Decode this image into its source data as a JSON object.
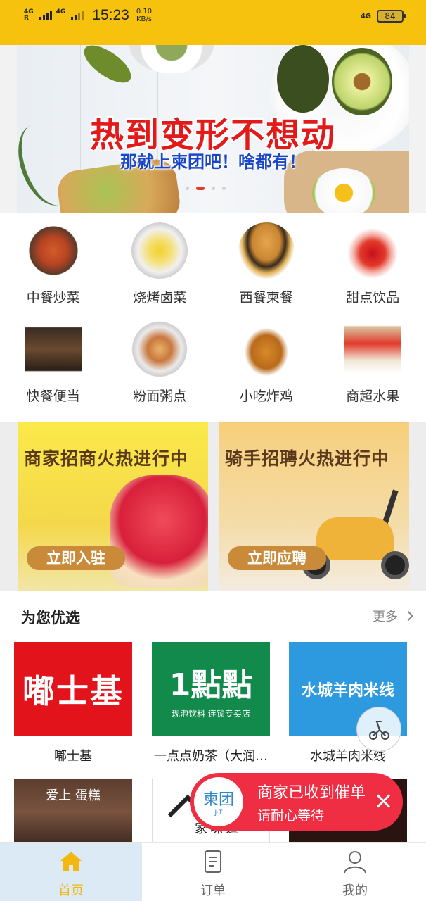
{
  "status_bar": {
    "network1": "4G",
    "network1_sub": "R",
    "network2": "4G",
    "time": "15:23",
    "speed_value": "0.10",
    "speed_unit": "KB/s",
    "network_right": "4G",
    "battery": "84"
  },
  "banner": {
    "title": "热到变形不想动",
    "subtitle": "那就上柬团吧！啥都有！",
    "active_dot": 1,
    "dot_count": 4
  },
  "categories": [
    {
      "label": "中餐炒菜",
      "icon": "stir-fry-icon"
    },
    {
      "label": "烧烤卤菜",
      "icon": "bbq-icon"
    },
    {
      "label": "西餐柬餐",
      "icon": "burger-icon"
    },
    {
      "label": "甜点饮品",
      "icon": "drink-icon"
    },
    {
      "label": "快餐便当",
      "icon": "bento-icon"
    },
    {
      "label": "粉面粥点",
      "icon": "noodle-icon"
    },
    {
      "label": "小吃炸鸡",
      "icon": "fried-chicken-icon"
    },
    {
      "label": "商超水果",
      "icon": "grocery-icon"
    }
  ],
  "promos": [
    {
      "title": "商家招商火热进行中",
      "button": "立即入驻"
    },
    {
      "title": "骑手招聘火热进行中",
      "button": "立即应聘"
    }
  ],
  "recommend": {
    "title": "为您优选",
    "more": "更多",
    "shops": [
      {
        "name": "嘟士基",
        "logo_text": "嘟士基",
        "color": "#e3131c"
      },
      {
        "name": "一点点奶茶（大润…",
        "logo_text": "1點點",
        "logo_sub": "现泡饮料 连锁专卖店",
        "color": "#118a4c"
      },
      {
        "name": "水城羊肉米线",
        "logo_text": "水城羊肉米线",
        "color": "#2d9ae0"
      }
    ],
    "row2": [
      {
        "logo_text": "爱上 蛋糕"
      },
      {
        "logo_text": "家味道"
      },
      {
        "logo_text": ""
      }
    ]
  },
  "toast": {
    "logo_main": "柬团",
    "logo_sub": "J·T",
    "line1": "商家已收到催单",
    "line2": "请耐心等待"
  },
  "tabbar": {
    "tabs": [
      {
        "label": "首页",
        "icon": "home-icon",
        "active": true
      },
      {
        "label": "订单",
        "icon": "order-icon",
        "active": false
      },
      {
        "label": "我的",
        "icon": "user-icon",
        "active": false
      }
    ]
  },
  "colors": {
    "brand_yellow": "#f6c20e",
    "toast_red": "#ef2d43",
    "banner_title_red": "#e21a1a",
    "banner_sub_blue": "#1a47c8"
  }
}
